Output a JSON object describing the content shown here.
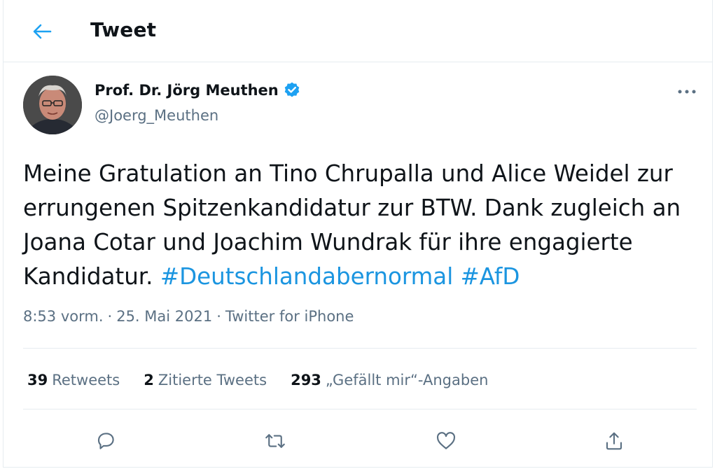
{
  "header": {
    "title": "Tweet",
    "back_icon": "arrow-left-icon"
  },
  "author": {
    "name": "Prof. Dr. Jörg Meuthen",
    "handle": "@Joerg_Meuthen",
    "verified": true
  },
  "tweet": {
    "text_plain": "Meine Gratulation an Tino Chrupalla und Alice Weidel zur errungenen Spitzenkandidatur zur BTW. Dank zugleich an Joana Cotar und Joachim Wundrak für ihre engagierte Kandidatur.",
    "hashtags": [
      "#Deutschlandabernormal",
      "#AfD"
    ]
  },
  "meta": {
    "time": "8:53 vorm.",
    "separator": "·",
    "date": "25. Mai 2021",
    "source": "Twitter for iPhone"
  },
  "stats": {
    "retweets_count": "39",
    "retweets_label": "Retweets",
    "quotes_count": "2",
    "quotes_label": "Zitierte Tweets",
    "likes_count": "293",
    "likes_label": "„Gefällt mir“-Angaben"
  },
  "actions": [
    "reply-icon",
    "retweet-icon",
    "like-icon",
    "share-icon"
  ],
  "colors": {
    "accent": "#1da1f2",
    "hashtag": "#1b95e0",
    "secondary_text": "#5b7083",
    "border": "#e6ecf0"
  }
}
